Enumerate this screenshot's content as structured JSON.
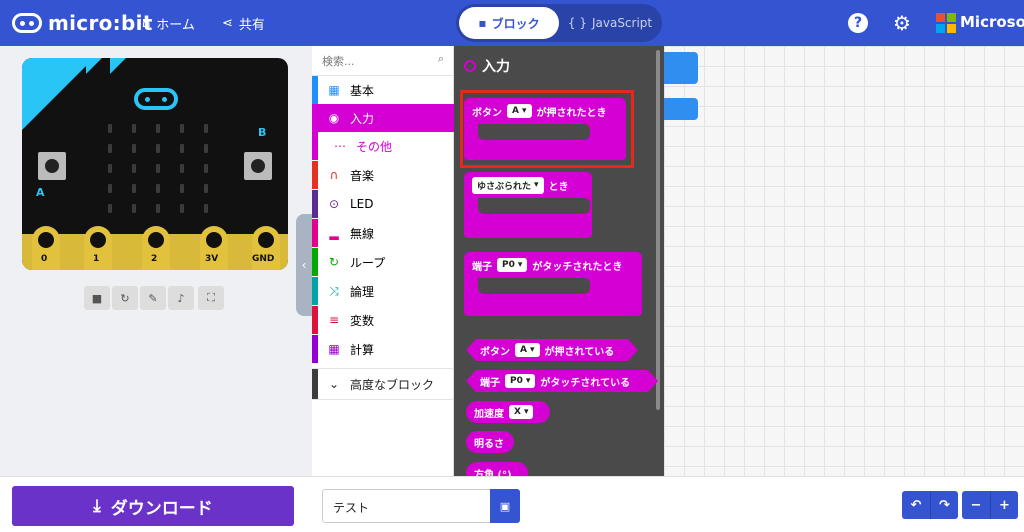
{
  "header": {
    "app_name": "micro:bit",
    "home_label": "ホーム",
    "share_label": "共有",
    "mode_blocks_label": "ブロック",
    "mode_js_label": "JavaScript",
    "mode_js_prefix": "{ }",
    "help_icon_label": "?",
    "brand_label": "Microsoft"
  },
  "simulator": {
    "button_a_label": "A",
    "button_b_label": "B",
    "pins": [
      "0",
      "1",
      "2",
      "3V",
      "GND"
    ],
    "controls": [
      "stop-icon",
      "restart-icon",
      "slowmo-icon",
      "mute-icon",
      "fullscreen-icon"
    ]
  },
  "toolbox": {
    "search_placeholder": "検索...",
    "categories": [
      {
        "label": "基本",
        "color": "#1e90ff"
      },
      {
        "label": "入力",
        "color": "#d400d4"
      },
      {
        "label": "その他",
        "color": "#d400d4"
      },
      {
        "label": "音楽",
        "color": "#e63022"
      },
      {
        "label": "LED",
        "color": "#5c2d91"
      },
      {
        "label": "無線",
        "color": "#e3008c"
      },
      {
        "label": "ループ",
        "color": "#00aa00"
      },
      {
        "label": "論理",
        "color": "#00a4a6"
      },
      {
        "label": "変数",
        "color": "#dc143c"
      },
      {
        "label": "計算",
        "color": "#9400d3"
      }
    ],
    "advanced_label": "高度なブロック"
  },
  "flyout": {
    "title": "入力",
    "blocks": {
      "on_button": {
        "pre": "ボタン",
        "dropdown": "A",
        "post": "が押されたとき"
      },
      "on_gesture": {
        "dropdown": "ゆさぶられた",
        "post": "とき"
      },
      "on_pin": {
        "pre": "端子",
        "dropdown": "P0",
        "post": "がタッチされたとき"
      },
      "is_button": {
        "pre": "ボタン",
        "dropdown": "A",
        "post": "が押されている"
      },
      "is_pin": {
        "pre": "端子",
        "dropdown": "P0",
        "post": "がタッチされている"
      },
      "accel": {
        "pre": "加速度",
        "dropdown": "X"
      },
      "light": {
        "label": "明るさ"
      },
      "compass": {
        "label": "方角 (°)"
      }
    }
  },
  "bottom": {
    "download_label": "ダウンロード",
    "project_name": "テスト"
  },
  "colors": {
    "header": "#3454d1",
    "input_category": "#d400d4",
    "download": "#6a32c9",
    "highlight": "#e8281c"
  }
}
